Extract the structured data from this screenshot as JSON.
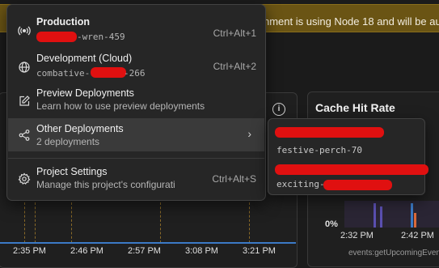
{
  "banner": {
    "text": "nment is using Node 18 and will be auto",
    "bg_color": "#6a5414"
  },
  "usage_chart": {
    "x_ticks": [
      "2:35 PM",
      "2:46 PM",
      "2:57 PM",
      "3:08 PM",
      "3:21 PM"
    ],
    "info_icon": "info-icon"
  },
  "cache_panel": {
    "title": "Cache Hit Rate",
    "y_label": "0%",
    "x_ticks": [
      "2:32 PM",
      "2:42 PM"
    ],
    "footer": "events:getUpcomingEvents"
  },
  "menu": {
    "items": [
      {
        "icon": "broadcast-icon",
        "title": "Production",
        "subtitle": "-wren-459",
        "shortcut": "Ctrl+Alt+1"
      },
      {
        "icon": "globe-icon",
        "title": "Development (Cloud)",
        "subtitle_prefix": "combative-",
        "subtitle_suffix": "-266",
        "shortcut": "Ctrl+Alt+2"
      },
      {
        "icon": "edit-icon",
        "title": "Preview Deployments",
        "subtitle": "Learn how to use preview deployments"
      },
      {
        "icon": "share-icon",
        "title": "Other Deployments",
        "subtitle": "2 deployments",
        "chevron": "›"
      },
      {
        "icon": "gear-icon",
        "title": "Project Settings",
        "subtitle": "Manage this project's configurati",
        "shortcut": "Ctrl+Alt+S"
      }
    ],
    "redaction_color": "#e01010"
  },
  "submenu": {
    "deployments": [
      "festive-perch-70",
      "exciting-"
    ]
  }
}
